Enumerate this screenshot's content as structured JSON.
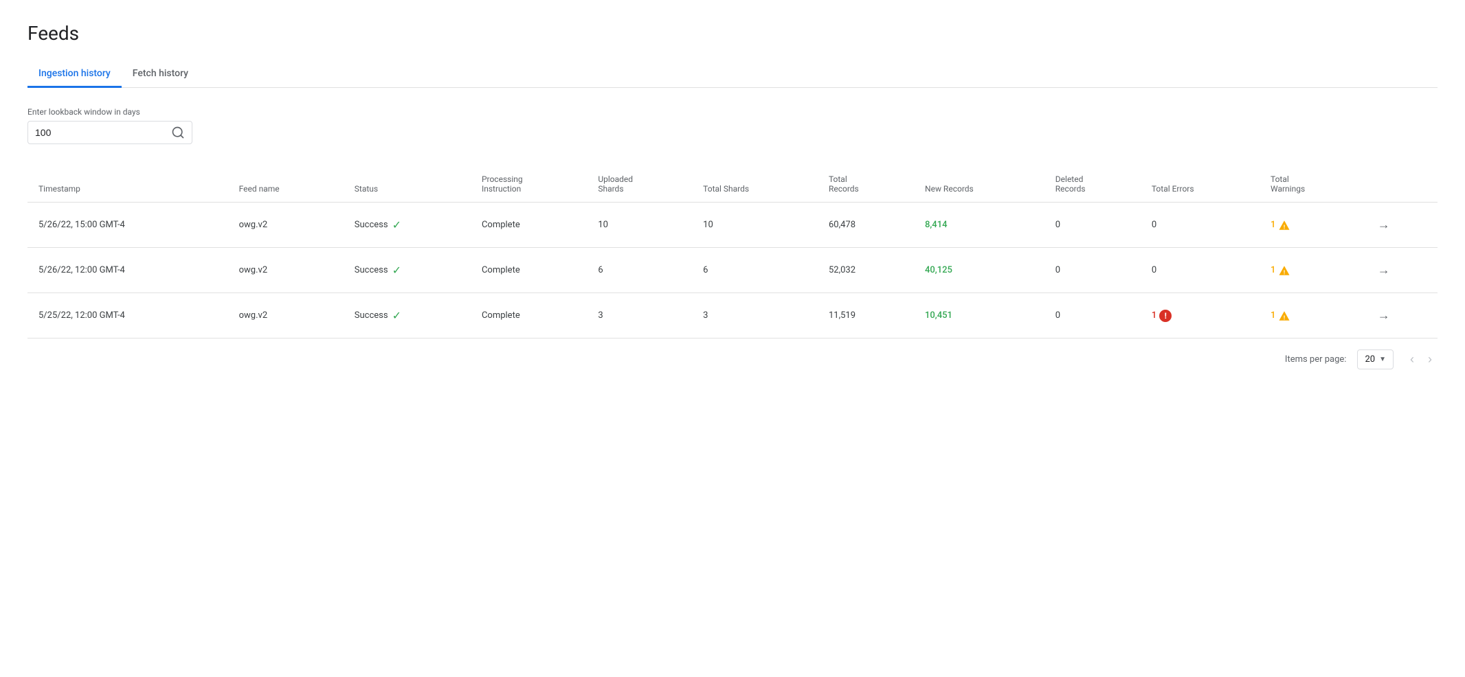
{
  "page": {
    "title": "Feeds"
  },
  "tabs": [
    {
      "id": "ingestion-history",
      "label": "Ingestion history",
      "active": true
    },
    {
      "id": "fetch-history",
      "label": "Fetch history",
      "active": false
    }
  ],
  "lookback": {
    "label": "Enter lookback window in days",
    "value": "100",
    "search_button_label": "Search"
  },
  "table": {
    "columns": [
      {
        "id": "timestamp",
        "label": "Timestamp"
      },
      {
        "id": "feed-name",
        "label": "Feed name"
      },
      {
        "id": "status",
        "label": "Status"
      },
      {
        "id": "processing-instruction",
        "label1": "Processing",
        "label2": "Instruction"
      },
      {
        "id": "uploaded-shards",
        "label1": "Uploaded",
        "label2": "Shards"
      },
      {
        "id": "total-shards",
        "label": "Total Shards"
      },
      {
        "id": "total-records",
        "label1": "Total",
        "label2": "Records"
      },
      {
        "id": "new-records",
        "label1": "New Records",
        "label2": ""
      },
      {
        "id": "deleted-records",
        "label1": "Deleted",
        "label2": "Records"
      },
      {
        "id": "total-errors",
        "label": "Total Errors"
      },
      {
        "id": "total-warnings",
        "label1": "Total",
        "label2": "Warnings"
      },
      {
        "id": "action",
        "label": ""
      }
    ],
    "rows": [
      {
        "timestamp": "5/26/22, 15:00 GMT-4",
        "feed_name": "owg.v2",
        "status": "Success",
        "processing_instruction": "Complete",
        "uploaded_shards": "10",
        "total_shards": "10",
        "total_records": "60,478",
        "new_records": "8,414",
        "deleted_records": "0",
        "total_errors": "0",
        "total_warnings": "1",
        "has_warning": true,
        "has_error": false
      },
      {
        "timestamp": "5/26/22, 12:00 GMT-4",
        "feed_name": "owg.v2",
        "status": "Success",
        "processing_instruction": "Complete",
        "uploaded_shards": "6",
        "total_shards": "6",
        "total_records": "52,032",
        "new_records": "40,125",
        "deleted_records": "0",
        "total_errors": "0",
        "total_warnings": "1",
        "has_warning": true,
        "has_error": false
      },
      {
        "timestamp": "5/25/22, 12:00 GMT-4",
        "feed_name": "owg.v2",
        "status": "Success",
        "processing_instruction": "Complete",
        "uploaded_shards": "3",
        "total_shards": "3",
        "total_records": "11,519",
        "new_records": "10,451",
        "deleted_records": "0",
        "total_errors": "1",
        "total_warnings": "1",
        "has_warning": true,
        "has_error": true
      }
    ]
  },
  "pagination": {
    "items_per_page_label": "Items per page:",
    "items_per_page_value": "20",
    "prev_label": "‹",
    "next_label": "›"
  },
  "icons": {
    "search": "🔍",
    "check": "✓",
    "warning_triangle": "⚠",
    "error_circle": "●",
    "arrow_right": "→",
    "chevron_down": "▼",
    "nav_prev": "‹",
    "nav_next": "›"
  }
}
